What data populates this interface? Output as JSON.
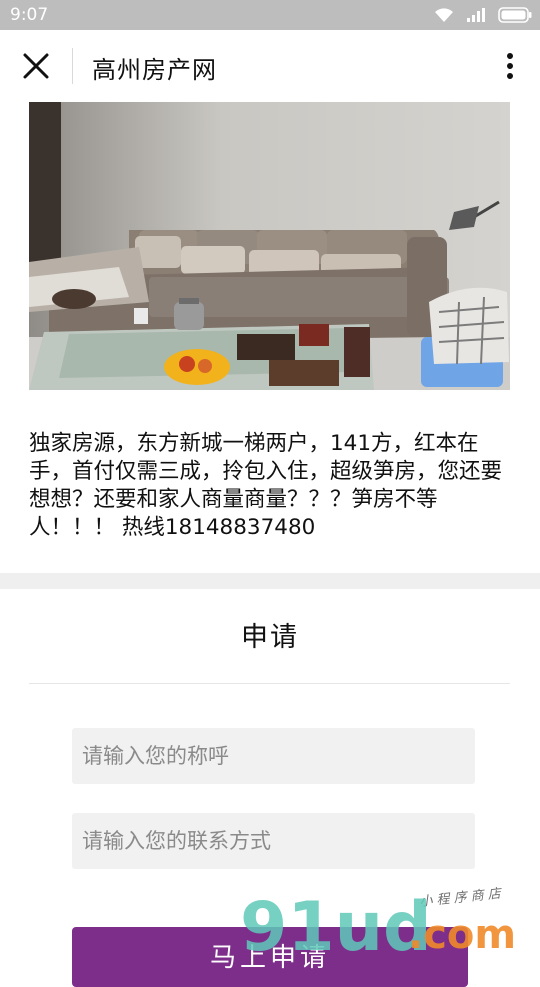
{
  "status_bar": {
    "time": "9:07",
    "icons": [
      "wifi-icon",
      "signal-icon",
      "battery-icon"
    ],
    "background": "#bdbdbd"
  },
  "nav": {
    "title": "高州房产网",
    "close_icon": "close-icon",
    "more_icon": "more-vertical-icon"
  },
  "listing": {
    "photo_subject": "living-room-photo",
    "description": "独家房源，东方新城一梯两户，141方，红本在手，首付仅需三成，拎包入住，超级笋房，您还要想想？还要和家人商量商量？？？笋房不等人！！！ 热线18148837480"
  },
  "apply": {
    "title": "申请",
    "name_placeholder": "请输入您的称呼",
    "contact_placeholder": "请输入您的联系方式",
    "submit_label": "马上申请",
    "button_color": "#7d2d8a"
  },
  "watermark": {
    "small_text": "小 程 序 商 店",
    "logo_text": "91ud.com"
  }
}
